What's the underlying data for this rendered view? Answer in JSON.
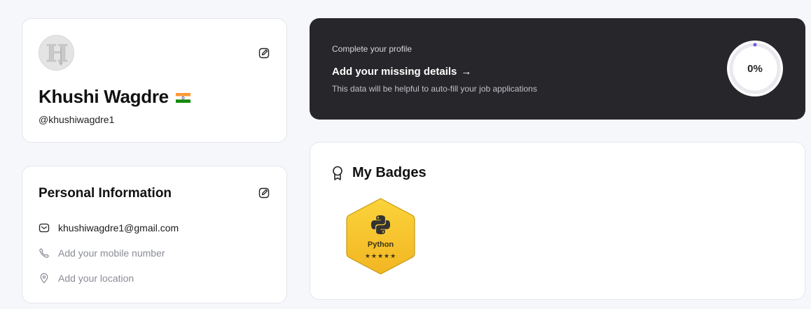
{
  "profile": {
    "name": "Khushi Wagdre",
    "username": "@khushiwagdre1",
    "avatar_letter": "H",
    "flag_icon": "india-flag-icon"
  },
  "personal_info": {
    "title": "Personal Information",
    "email": "khushiwagdre1@gmail.com",
    "phone_placeholder": "Add your mobile number",
    "location_placeholder": "Add your location"
  },
  "complete_profile": {
    "eyebrow": "Complete your profile",
    "link_label": "Add your missing details",
    "arrow": "→",
    "description": "This data will be helpful to auto-fill your job applications",
    "progress_label": "0%",
    "progress_value": 0
  },
  "badges": {
    "title": "My Badges",
    "items": [
      {
        "name": "Python",
        "stars": "★★★★★",
        "rating": 5,
        "icon": "python-logo-icon"
      }
    ]
  },
  "colors": {
    "background": "#f6f7fb",
    "dark_card": "#27272b",
    "badge_gold": "#f7c325",
    "muted_text": "#8a8d96"
  }
}
